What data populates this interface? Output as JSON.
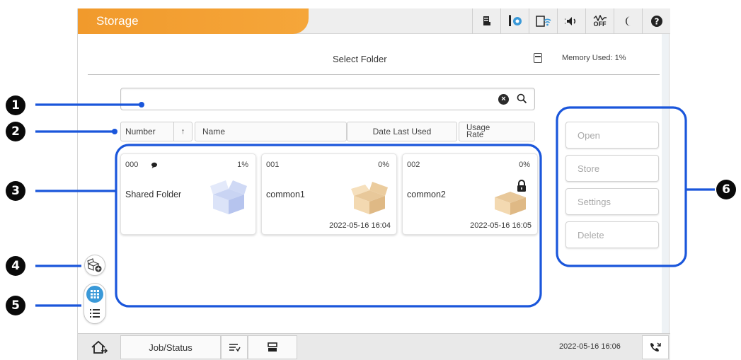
{
  "app": {
    "title": "Storage"
  },
  "status_icons": [
    "toner-icon",
    "info-icon",
    "wifi-icon",
    "volume-icon",
    "fax-off-icon",
    "sleep-icon",
    "help-icon"
  ],
  "status": {
    "fax_off_label": "OFF"
  },
  "header": {
    "title": "Select Folder",
    "memory_used": "Memory Used: 1%"
  },
  "search": {
    "value": "",
    "placeholder": ""
  },
  "columns": {
    "number": "Number",
    "sort": "↑",
    "name": "Name",
    "date_last_used": "Date Last Used",
    "usage_rate": "Usage Rate"
  },
  "folders": [
    {
      "number": "000",
      "usage": "1%",
      "name": "Shared Folder",
      "date": "",
      "locked": false,
      "has_comment": true
    },
    {
      "number": "001",
      "usage": "0%",
      "name": "common1",
      "date": "2022-05-16 16:04",
      "locked": false,
      "has_comment": false
    },
    {
      "number": "002",
      "usage": "0%",
      "name": "common2",
      "date": "2022-05-16 16:05",
      "locked": true,
      "has_comment": false
    }
  ],
  "actions": [
    "Open",
    "Store",
    "Settings",
    "Delete"
  ],
  "bottom": {
    "job_status": "Job/Status",
    "datetime": "2022-05-16 16:06"
  },
  "callouts": [
    "1",
    "2",
    "3",
    "4",
    "5",
    "6"
  ],
  "colors": {
    "accent": "#f19a2c",
    "highlight": "#1a56db",
    "callout": "#0a0a0a"
  }
}
